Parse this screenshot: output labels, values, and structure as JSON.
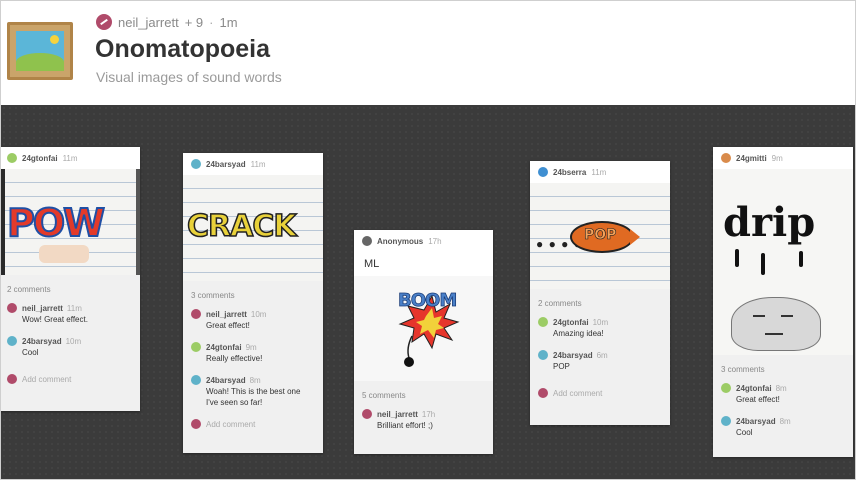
{
  "header": {
    "author": "neil_jarrett",
    "author_extra": "+ 9",
    "time": "1m",
    "title": "Onomatopoeia",
    "subtitle": "Visual images of sound words"
  },
  "cards": [
    {
      "author": "24gtonfai",
      "time": "11m",
      "art": "POW",
      "comments_count": "2 comments",
      "comments": [
        {
          "author": "neil_jarrett",
          "time": "11m",
          "text": "Wow! Great effect."
        },
        {
          "author": "24barsyad",
          "time": "10m",
          "text": "Cool"
        }
      ],
      "add_comment": "Add comment"
    },
    {
      "author": "24barsyad",
      "time": "11m",
      "art": "CRACK",
      "comments_count": "3 comments",
      "comments": [
        {
          "author": "neil_jarrett",
          "time": "10m",
          "text": "Great effect!"
        },
        {
          "author": "24gtonfai",
          "time": "9m",
          "text": "Really effective!"
        },
        {
          "author": "24barsyad",
          "time": "8m",
          "text": "Woah! This is the best one I've seen so far!"
        }
      ],
      "add_comment": "Add comment"
    },
    {
      "author": "Anonymous",
      "time": "17h",
      "text": "ML",
      "art": "BOOM",
      "comments_count": "5 comments",
      "comments": [
        {
          "author": "neil_jarrett",
          "time": "17h",
          "text": "Brilliant effort! ;)"
        }
      ]
    },
    {
      "author": "24bserra",
      "time": "11m",
      "art": "POP",
      "comments_count": "2 comments",
      "comments": [
        {
          "author": "24gtonfai",
          "time": "10m",
          "text": "Amazing idea!"
        },
        {
          "author": "24barsyad",
          "time": "6m",
          "text": "POP"
        }
      ],
      "add_comment": "Add comment"
    },
    {
      "author": "24gmitti",
      "time": "9m",
      "art": "drip",
      "comments_count": "3 comments",
      "comments": [
        {
          "author": "24gtonfai",
          "time": "8m",
          "text": "Great effect!"
        },
        {
          "author": "24barsyad",
          "time": "8m",
          "text": "Cool"
        }
      ]
    }
  ]
}
